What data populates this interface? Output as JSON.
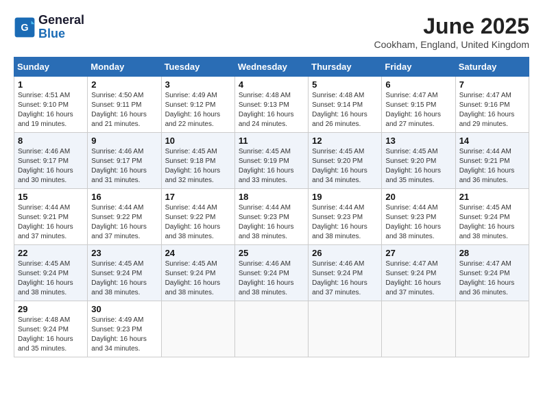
{
  "header": {
    "logo_line1": "General",
    "logo_line2": "Blue",
    "title": "June 2025",
    "location": "Cookham, England, United Kingdom"
  },
  "weekdays": [
    "Sunday",
    "Monday",
    "Tuesday",
    "Wednesday",
    "Thursday",
    "Friday",
    "Saturday"
  ],
  "weeks": [
    [
      {
        "day": "1",
        "info": "Sunrise: 4:51 AM\nSunset: 9:10 PM\nDaylight: 16 hours\nand 19 minutes."
      },
      {
        "day": "2",
        "info": "Sunrise: 4:50 AM\nSunset: 9:11 PM\nDaylight: 16 hours\nand 21 minutes."
      },
      {
        "day": "3",
        "info": "Sunrise: 4:49 AM\nSunset: 9:12 PM\nDaylight: 16 hours\nand 22 minutes."
      },
      {
        "day": "4",
        "info": "Sunrise: 4:48 AM\nSunset: 9:13 PM\nDaylight: 16 hours\nand 24 minutes."
      },
      {
        "day": "5",
        "info": "Sunrise: 4:48 AM\nSunset: 9:14 PM\nDaylight: 16 hours\nand 26 minutes."
      },
      {
        "day": "6",
        "info": "Sunrise: 4:47 AM\nSunset: 9:15 PM\nDaylight: 16 hours\nand 27 minutes."
      },
      {
        "day": "7",
        "info": "Sunrise: 4:47 AM\nSunset: 9:16 PM\nDaylight: 16 hours\nand 29 minutes."
      }
    ],
    [
      {
        "day": "8",
        "info": "Sunrise: 4:46 AM\nSunset: 9:17 PM\nDaylight: 16 hours\nand 30 minutes."
      },
      {
        "day": "9",
        "info": "Sunrise: 4:46 AM\nSunset: 9:17 PM\nDaylight: 16 hours\nand 31 minutes."
      },
      {
        "day": "10",
        "info": "Sunrise: 4:45 AM\nSunset: 9:18 PM\nDaylight: 16 hours\nand 32 minutes."
      },
      {
        "day": "11",
        "info": "Sunrise: 4:45 AM\nSunset: 9:19 PM\nDaylight: 16 hours\nand 33 minutes."
      },
      {
        "day": "12",
        "info": "Sunrise: 4:45 AM\nSunset: 9:20 PM\nDaylight: 16 hours\nand 34 minutes."
      },
      {
        "day": "13",
        "info": "Sunrise: 4:45 AM\nSunset: 9:20 PM\nDaylight: 16 hours\nand 35 minutes."
      },
      {
        "day": "14",
        "info": "Sunrise: 4:44 AM\nSunset: 9:21 PM\nDaylight: 16 hours\nand 36 minutes."
      }
    ],
    [
      {
        "day": "15",
        "info": "Sunrise: 4:44 AM\nSunset: 9:21 PM\nDaylight: 16 hours\nand 37 minutes."
      },
      {
        "day": "16",
        "info": "Sunrise: 4:44 AM\nSunset: 9:22 PM\nDaylight: 16 hours\nand 37 minutes."
      },
      {
        "day": "17",
        "info": "Sunrise: 4:44 AM\nSunset: 9:22 PM\nDaylight: 16 hours\nand 38 minutes."
      },
      {
        "day": "18",
        "info": "Sunrise: 4:44 AM\nSunset: 9:23 PM\nDaylight: 16 hours\nand 38 minutes."
      },
      {
        "day": "19",
        "info": "Sunrise: 4:44 AM\nSunset: 9:23 PM\nDaylight: 16 hours\nand 38 minutes."
      },
      {
        "day": "20",
        "info": "Sunrise: 4:44 AM\nSunset: 9:23 PM\nDaylight: 16 hours\nand 38 minutes."
      },
      {
        "day": "21",
        "info": "Sunrise: 4:45 AM\nSunset: 9:24 PM\nDaylight: 16 hours\nand 38 minutes."
      }
    ],
    [
      {
        "day": "22",
        "info": "Sunrise: 4:45 AM\nSunset: 9:24 PM\nDaylight: 16 hours\nand 38 minutes."
      },
      {
        "day": "23",
        "info": "Sunrise: 4:45 AM\nSunset: 9:24 PM\nDaylight: 16 hours\nand 38 minutes."
      },
      {
        "day": "24",
        "info": "Sunrise: 4:45 AM\nSunset: 9:24 PM\nDaylight: 16 hours\nand 38 minutes."
      },
      {
        "day": "25",
        "info": "Sunrise: 4:46 AM\nSunset: 9:24 PM\nDaylight: 16 hours\nand 38 minutes."
      },
      {
        "day": "26",
        "info": "Sunrise: 4:46 AM\nSunset: 9:24 PM\nDaylight: 16 hours\nand 37 minutes."
      },
      {
        "day": "27",
        "info": "Sunrise: 4:47 AM\nSunset: 9:24 PM\nDaylight: 16 hours\nand 37 minutes."
      },
      {
        "day": "28",
        "info": "Sunrise: 4:47 AM\nSunset: 9:24 PM\nDaylight: 16 hours\nand 36 minutes."
      }
    ],
    [
      {
        "day": "29",
        "info": "Sunrise: 4:48 AM\nSunset: 9:24 PM\nDaylight: 16 hours\nand 35 minutes."
      },
      {
        "day": "30",
        "info": "Sunrise: 4:49 AM\nSunset: 9:23 PM\nDaylight: 16 hours\nand 34 minutes."
      },
      {
        "day": "",
        "info": ""
      },
      {
        "day": "",
        "info": ""
      },
      {
        "day": "",
        "info": ""
      },
      {
        "day": "",
        "info": ""
      },
      {
        "day": "",
        "info": ""
      }
    ]
  ]
}
